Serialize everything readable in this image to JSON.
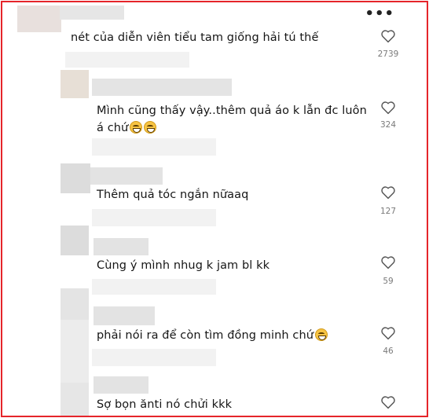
{
  "menu_icon": "more-horizontal-icon",
  "like_icon": "heart-outline-icon",
  "comments": [
    {
      "text": "nét của diễn viên tiểu tam giống hải tú thế",
      "likes": "2739",
      "emoji": 0
    },
    {
      "text": "Mình cũng thấy vậy..thêm quả áo k lẫn đc luôn á chứ",
      "likes": "324",
      "emoji": 2
    },
    {
      "text": "Thêm quả tóc ngắn nữaaq",
      "likes": "127",
      "emoji": 0
    },
    {
      "text": "Cùng ý mình nhug k jam bl kk",
      "likes": "59",
      "emoji": 0
    },
    {
      "text": "phải nói ra để còn tìm đồng minh chứ",
      "likes": "46",
      "emoji": 1
    },
    {
      "text": "Sợ bọn ănti nó chửi kkk",
      "likes": "",
      "emoji": 0
    }
  ]
}
